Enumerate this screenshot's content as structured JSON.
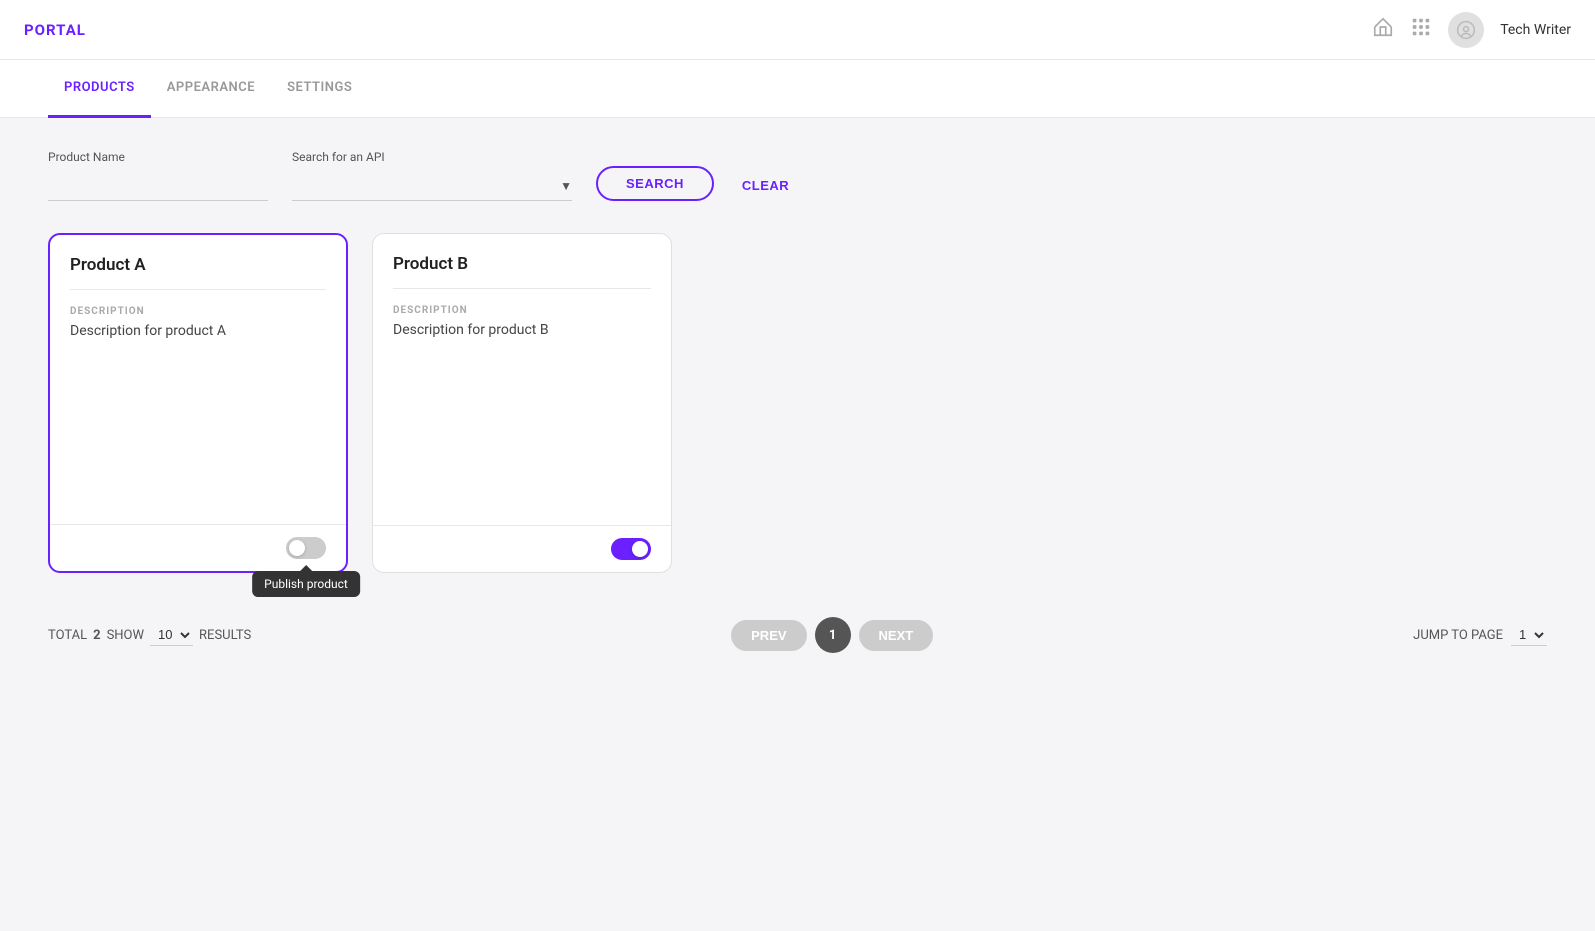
{
  "header": {
    "logo": "PORTAL",
    "username": "Tech Writer",
    "home_icon": "⌂",
    "grid_icon": "⋮⋮⋮"
  },
  "tabs": [
    {
      "id": "products",
      "label": "PRODUCTS",
      "active": true
    },
    {
      "id": "appearance",
      "label": "APPEARANCE",
      "active": false
    },
    {
      "id": "settings",
      "label": "SETTINGS",
      "active": false
    }
  ],
  "search": {
    "product_name_label": "Product Name",
    "product_name_placeholder": "",
    "api_label": "Search for an API",
    "api_placeholder": "",
    "search_button": "SEARCH",
    "clear_button": "CLEAR"
  },
  "products": [
    {
      "id": "product-a",
      "title": "Product A",
      "description_label": "DESCRIPTION",
      "description": "Description for product A",
      "published": false,
      "selected": true
    },
    {
      "id": "product-b",
      "title": "Product B",
      "description_label": "DESCRIPTION",
      "description": "Description for product B",
      "published": true,
      "selected": false
    }
  ],
  "tooltip": {
    "text": "Publish product"
  },
  "pagination": {
    "total_label": "TOTAL",
    "total": "2",
    "show_label": "SHOW",
    "show_value": "10",
    "results_label": "RESULTS",
    "prev_label": "PREV",
    "next_label": "NEXT",
    "current_page": "1",
    "jump_label": "JUMP TO PAGE",
    "jump_value": "1"
  }
}
